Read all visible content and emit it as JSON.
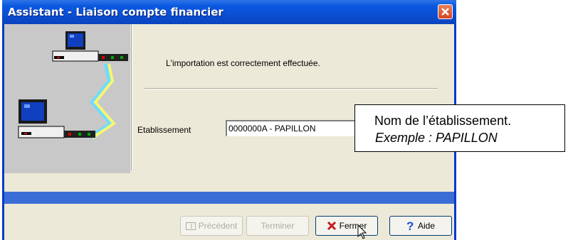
{
  "window": {
    "title": "Assistant - Liaison compte financier"
  },
  "content": {
    "message": "L'importation est correctement effectuée.",
    "field_label": "Etablissement",
    "field_value": "0000000A - PAPILLON"
  },
  "buttons": {
    "previous": "Précédent",
    "finish": "Terminer",
    "close": "Fermer",
    "help": "Aide"
  },
  "callout": {
    "line1": "Nom de l’établissement.",
    "line2": "Exemple : PAPILLON"
  },
  "colors": {
    "title_bar": "#0a4fd3",
    "progress_band": "#3a6ed6",
    "dialog_bg": "#ece9d8"
  }
}
